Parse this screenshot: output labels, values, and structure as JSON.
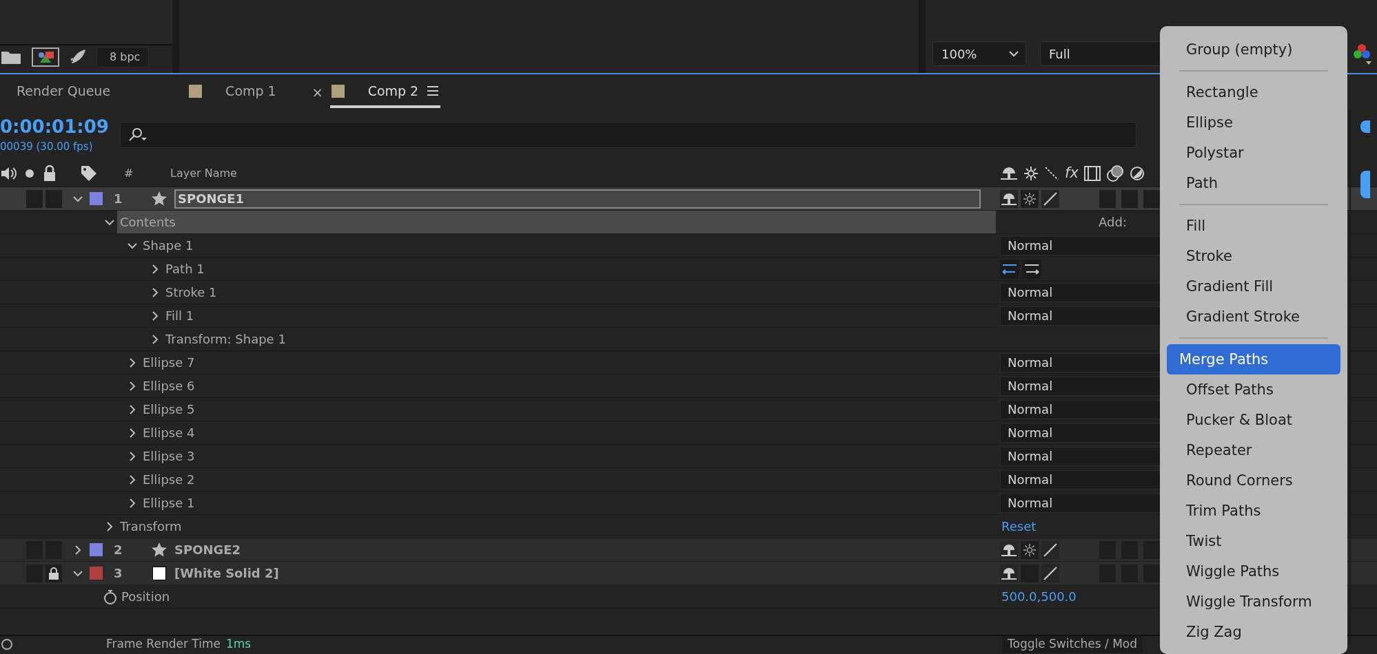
{
  "project_panel": {
    "bit_depth": "8 bpc"
  },
  "viewer": {
    "zoom": "100%",
    "resolution": "Full"
  },
  "tabs": [
    {
      "kind": "queue",
      "label": "Render Queue",
      "selected": false
    },
    {
      "kind": "comp",
      "label": "Comp 1",
      "selected": false,
      "color": "#b0a07c"
    },
    {
      "kind": "comp",
      "label": "Comp 2",
      "selected": true,
      "color": "#b0a07c",
      "close": "×"
    }
  ],
  "timecode": "0:00:01:09",
  "frame_info": "00039 (30.00 fps)",
  "columns": {
    "number": "#",
    "name": "Layer Name",
    "fx": "fx"
  },
  "layers": [
    {
      "kind": "shape_layer",
      "number": "1",
      "name": "SPONGE1",
      "color": "#7b83df",
      "expanded": true,
      "selected": true,
      "locked": false,
      "collapse": true,
      "children": [
        {
          "kind": "group",
          "name": "Contents",
          "expanded": true,
          "selected": true,
          "value": "Add:",
          "children": [
            {
              "kind": "group",
              "name": "Shape 1",
              "expanded": true,
              "mode": "Normal",
              "children": [
                {
                  "kind": "path",
                  "name": "Path 1",
                  "expanded": false
                },
                {
                  "kind": "group",
                  "name": "Stroke 1",
                  "expanded": false,
                  "mode": "Normal"
                },
                {
                  "kind": "group",
                  "name": "Fill 1",
                  "expanded": false,
                  "mode": "Normal"
                },
                {
                  "kind": "group",
                  "name": "Transform: Shape 1",
                  "expanded": false
                }
              ]
            },
            {
              "kind": "group",
              "name": "Ellipse 7",
              "expanded": false,
              "mode": "Normal"
            },
            {
              "kind": "group",
              "name": "Ellipse 6",
              "expanded": false,
              "mode": "Normal"
            },
            {
              "kind": "group",
              "name": "Ellipse 5",
              "expanded": false,
              "mode": "Normal"
            },
            {
              "kind": "group",
              "name": "Ellipse 4",
              "expanded": false,
              "mode": "Normal"
            },
            {
              "kind": "group",
              "name": "Ellipse 3",
              "expanded": false,
              "mode": "Normal"
            },
            {
              "kind": "group",
              "name": "Ellipse 2",
              "expanded": false,
              "mode": "Normal"
            },
            {
              "kind": "group",
              "name": "Ellipse 1",
              "expanded": false,
              "mode": "Normal"
            }
          ]
        },
        {
          "kind": "group",
          "name": "Transform",
          "expanded": false,
          "value": "Reset"
        }
      ]
    },
    {
      "kind": "shape_layer",
      "number": "2",
      "name": "SPONGE2",
      "color": "#7b83df",
      "expanded": false,
      "selected": false,
      "locked": false,
      "collapse": true
    },
    {
      "kind": "solid_layer",
      "number": "3",
      "name": "[White Solid 2]",
      "color": "#b04040",
      "expanded": true,
      "selected": false,
      "locked": true,
      "collapse": false,
      "children": [
        {
          "kind": "property",
          "name": "Position",
          "value": "500.0,500.0"
        }
      ]
    }
  ],
  "footer": {
    "render_label": "Frame Render Time",
    "render_time": "1ms",
    "toggle": "Toggle Switches / Mod"
  },
  "menu": [
    [
      {
        "label": "Group (empty)",
        "selected": false
      }
    ],
    [
      {
        "label": "Rectangle",
        "selected": false
      },
      {
        "label": "Ellipse",
        "selected": false
      },
      {
        "label": "Polystar",
        "selected": false
      },
      {
        "label": "Path",
        "selected": false
      }
    ],
    [
      {
        "label": "Fill",
        "selected": false
      },
      {
        "label": "Stroke",
        "selected": false
      },
      {
        "label": "Gradient Fill",
        "selected": false
      },
      {
        "label": "Gradient Stroke",
        "selected": false
      }
    ],
    [
      {
        "label": "Merge Paths",
        "selected": true
      },
      {
        "label": "Offset Paths",
        "selected": false
      },
      {
        "label": "Pucker & Bloat",
        "selected": false
      },
      {
        "label": "Repeater",
        "selected": false
      },
      {
        "label": "Round Corners",
        "selected": false
      },
      {
        "label": "Trim Paths",
        "selected": false
      },
      {
        "label": "Twist",
        "selected": false
      },
      {
        "label": "Wiggle Paths",
        "selected": false
      },
      {
        "label": "Wiggle Transform",
        "selected": false
      },
      {
        "label": "Zig Zag",
        "selected": false
      }
    ]
  ]
}
